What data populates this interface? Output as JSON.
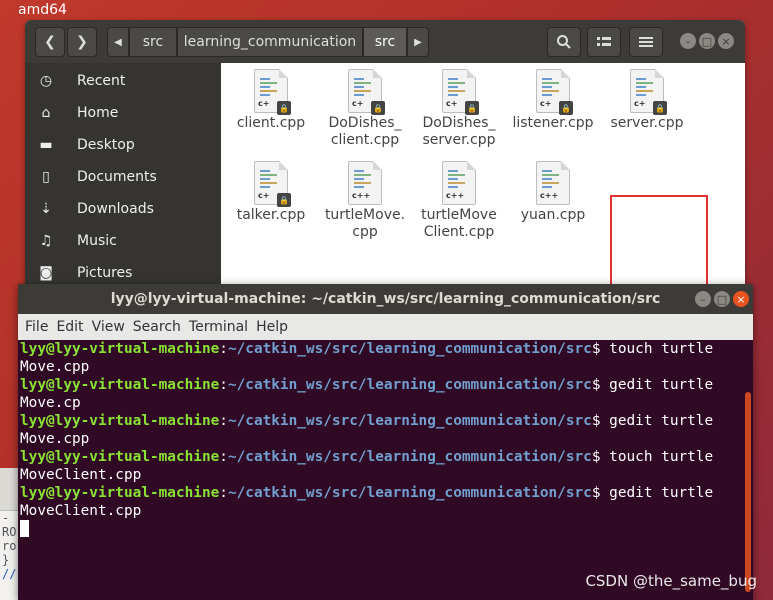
{
  "desktop": {
    "label": "amd64"
  },
  "file_manager": {
    "breadcrumbs": [
      "src",
      "learning_communication",
      "src"
    ],
    "sidebar": [
      {
        "label": "Recent",
        "icon": "clock-icon"
      },
      {
        "label": "Home",
        "icon": "home-icon"
      },
      {
        "label": "Desktop",
        "icon": "folder-icon"
      },
      {
        "label": "Documents",
        "icon": "document-icon"
      },
      {
        "label": "Downloads",
        "icon": "download-icon"
      },
      {
        "label": "Music",
        "icon": "music-icon"
      },
      {
        "label": "Pictures",
        "icon": "camera-icon"
      }
    ],
    "files": [
      {
        "line1": "client.cpp",
        "line2": "",
        "tag": "c+",
        "locked": true
      },
      {
        "line1": "DoDishes_",
        "line2": "client.cpp",
        "tag": "c+",
        "locked": true
      },
      {
        "line1": "DoDishes_",
        "line2": "server.cpp",
        "tag": "c+",
        "locked": true
      },
      {
        "line1": "listener.cpp",
        "line2": "",
        "tag": "c+",
        "locked": true
      },
      {
        "line1": "server.cpp",
        "line2": "",
        "tag": "c+",
        "locked": true
      },
      {
        "line1": "talker.cpp",
        "line2": "",
        "tag": "c+",
        "locked": true
      },
      {
        "line1": "turtleMove.",
        "line2": "cpp",
        "tag": "c++",
        "locked": false
      },
      {
        "line1": "turtleMove",
        "line2": "Client.cpp",
        "tag": "c++",
        "locked": false
      },
      {
        "line1": "yuan.cpp",
        "line2": "",
        "tag": "c++",
        "locked": false
      }
    ]
  },
  "terminal": {
    "title": "lyy@lyy-virtual-machine: ~/catkin_ws/src/learning_communication/src",
    "menu": [
      "File",
      "Edit",
      "View",
      "Search",
      "Terminal",
      "Help"
    ],
    "prompt_user": "lyy@lyy-virtual-machine",
    "prompt_sep": ":",
    "prompt_path": "~/catkin_ws/src/learning_communication/src",
    "prompt_end": "$ ",
    "commands": [
      {
        "cmd": "touch turtle",
        "wrap": "Move.cpp"
      },
      {
        "cmd": "gedit turtle",
        "wrap": "Move.cp"
      },
      {
        "cmd": "gedit turtle",
        "wrap": "Move.cpp"
      },
      {
        "cmd": "touch turtle",
        "wrap": "MoveClient.cpp"
      },
      {
        "cmd": "gedit turtle",
        "wrap": "MoveClient.cpp"
      }
    ]
  },
  "background_editor": {
    "lines": [
      "-",
      "RO",
      "ro",
      "}",
      "//"
    ]
  },
  "watermark": "CSDN @the_same_bug",
  "colors": {
    "accent": "#e95420",
    "terminal_bg": "#300a24",
    "prompt_user": "#8ae234",
    "prompt_path": "#729fcf",
    "highlight": "#e03131"
  }
}
